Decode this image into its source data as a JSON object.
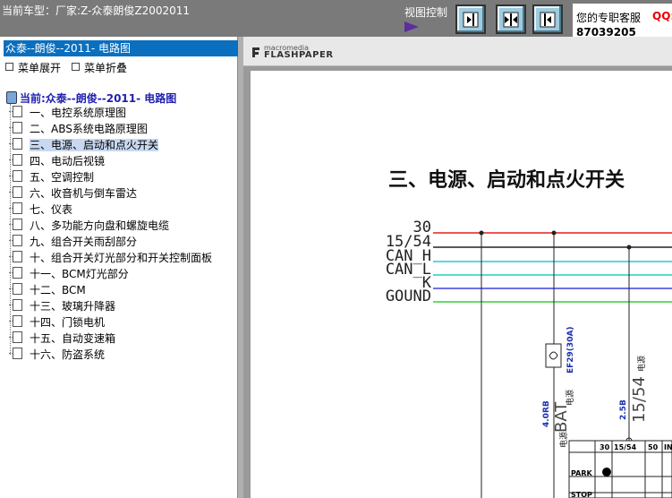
{
  "topbar": {
    "car_info": "当前车型：厂家:Z-众泰朗俊Z2002011",
    "view_control": "视图控制",
    "buttons": [
      {
        "icon": "collapse-left-icon"
      },
      {
        "icon": "center-split-icon"
      },
      {
        "icon": "collapse-right-icon"
      }
    ],
    "service_label": "您的专职客服",
    "qq_label": "QQ:",
    "service_number": "87039205"
  },
  "sidebar": {
    "title": "众泰--朗俊--2011- 电路图",
    "expand_label": "菜单展开",
    "collapse_label": "菜单折叠",
    "root_label": "当前:众泰--朗俊--2011- 电路图",
    "items": [
      {
        "label": "一、电控系统原理图"
      },
      {
        "label": "二、ABS系统电路原理图"
      },
      {
        "label": "三、电源、启动和点火开关",
        "selected": true
      },
      {
        "label": "四、电动后视镜"
      },
      {
        "label": "五、空调控制"
      },
      {
        "label": "六、收音机与倒车雷达"
      },
      {
        "label": "七、仪表"
      },
      {
        "label": "八、多功能方向盘和螺旋电缆"
      },
      {
        "label": "九、组合开关雨刮部分"
      },
      {
        "label": "十、组合开关灯光部分和开关控制面板"
      },
      {
        "label": "十一、BCM灯光部分"
      },
      {
        "label": "十二、BCM"
      },
      {
        "label": "十三、玻璃升降器"
      },
      {
        "label": "十四、门锁电机"
      },
      {
        "label": "十五、自动变速箱"
      },
      {
        "label": "十六、防盗系统"
      }
    ]
  },
  "viewer": {
    "logo_small": "macromedia",
    "logo_big": "FLASHPAPER",
    "doc_title": "三、电源、启动和点火开关",
    "wires": [
      {
        "label": "30",
        "color": "#e02020"
      },
      {
        "label": "15/54",
        "color": "#222222"
      },
      {
        "label": "CAN_H",
        "color": "#20c8e0"
      },
      {
        "label": "CAN_L",
        "color": "#20d0c0"
      },
      {
        "label": "K",
        "color": "#4040e0"
      },
      {
        "label": "GOUND",
        "color": "#30d030"
      }
    ],
    "fuse_label": "EF29(30A)",
    "fuse_side": "电源",
    "bat_label": "BAT",
    "bat_side": "电源",
    "wire1_code": "4.0RB",
    "wire2_code": "2.5B",
    "vlabel_1554": "15/54",
    "vlabel_1554_side": "电源",
    "table_headers": [
      "30",
      "15/54",
      "50",
      "IN"
    ],
    "table_rows": [
      "PARK",
      "STOP"
    ]
  }
}
